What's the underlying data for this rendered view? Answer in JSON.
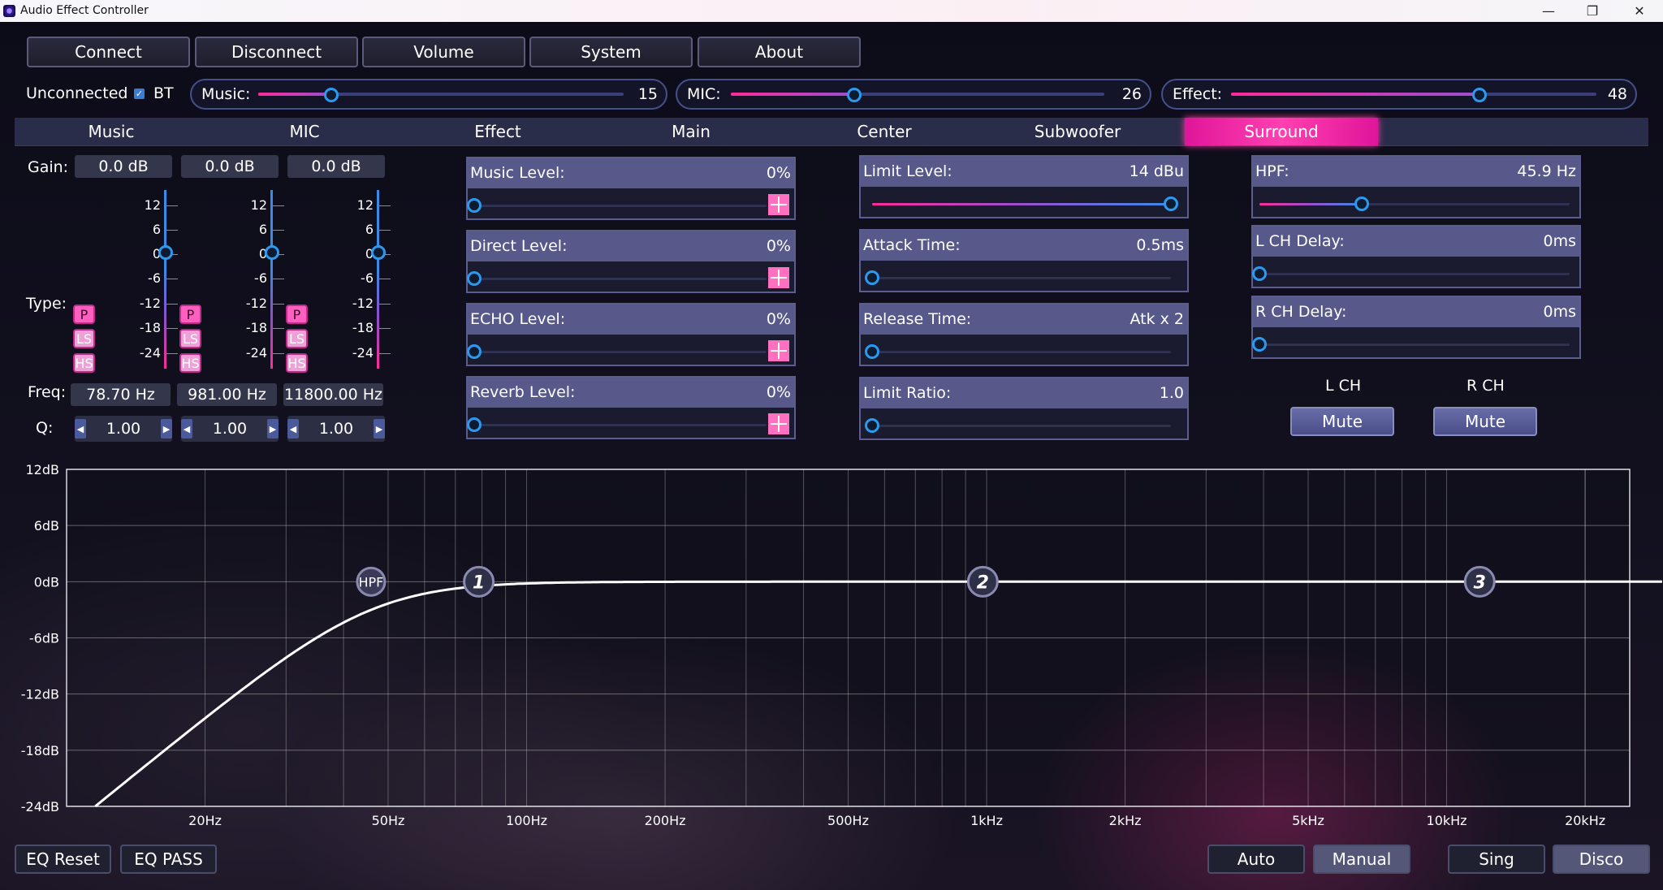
{
  "window": {
    "title": "Audio Effect Controller",
    "minimize": "—",
    "maximize": "❐",
    "close": "✕"
  },
  "menu": [
    "Connect",
    "Disconnect",
    "Volume",
    "System",
    "About"
  ],
  "status": {
    "connection": "Unconnected",
    "bt_label": "BT",
    "bt_checked": true
  },
  "levels": [
    {
      "label": "Music:",
      "value": "15",
      "fraction": 0.2
    },
    {
      "label": "MIC:",
      "value": "26",
      "fraction": 0.33
    },
    {
      "label": "Effect:",
      "value": "48",
      "fraction": 0.68
    }
  ],
  "tabs": [
    "Music",
    "MIC",
    "Effect",
    "Main",
    "Center",
    "Subwoofer",
    "Surround"
  ],
  "active_tab": "Surround",
  "eq": {
    "gain_label": "Gain:",
    "type_label": "Type:",
    "freq_label": "Freq:",
    "q_label": "Q:",
    "scale": [
      "12",
      "6",
      "0",
      "-6",
      "-12",
      "-18",
      "-24"
    ],
    "types": [
      "P",
      "LS",
      "HS"
    ],
    "bands": [
      {
        "gain": "0.0 dB",
        "freq": "78.70 Hz",
        "q": "1.00",
        "type": "P"
      },
      {
        "gain": "0.0 dB",
        "freq": "981.00 Hz",
        "q": "1.00",
        "type": "P"
      },
      {
        "gain": "0.0 dB",
        "freq": "11800.00 Hz",
        "q": "1.00",
        "type": "P"
      }
    ]
  },
  "effect_panels": [
    {
      "label": "Music Level:",
      "value": "0%",
      "fraction": 0
    },
    {
      "label": "Direct Level:",
      "value": "0%",
      "fraction": 0
    },
    {
      "label": "ECHO Level:",
      "value": "0%",
      "fraction": 0
    },
    {
      "label": "Reverb Level:",
      "value": "0%",
      "fraction": 0
    }
  ],
  "limiter_panels": [
    {
      "label": "Limit Level:",
      "value": "14 dBu",
      "fraction": 1.0
    },
    {
      "label": "Attack Time:",
      "value": "0.5ms",
      "fraction": 0
    },
    {
      "label": "Release Time:",
      "value": "Atk x  2",
      "fraction": 0
    },
    {
      "label": "Limit Ratio:",
      "value": "1.0",
      "fraction": 0
    }
  ],
  "surround_panels": [
    {
      "label": "HPF:",
      "value": "45.9 Hz",
      "fraction": 0.33
    },
    {
      "label": "L CH Delay:",
      "value": "0ms",
      "fraction": 0
    },
    {
      "label": "R CH Delay:",
      "value": "0ms",
      "fraction": 0
    }
  ],
  "channels": [
    {
      "label": "L CH",
      "button": "Mute"
    },
    {
      "label": "R CH",
      "button": "Mute"
    }
  ],
  "graph": {
    "y_labels": [
      "12dB",
      "6dB",
      "0dB",
      "-6dB",
      "-12dB",
      "-18dB",
      "-24dB"
    ],
    "x_labels": [
      "20Hz",
      "50Hz",
      "100Hz",
      "200Hz",
      "500Hz",
      "1kHz",
      "2kHz",
      "5kHz",
      "10kHz",
      "20kHz"
    ],
    "x_label_freqs": [
      20,
      50,
      100,
      200,
      500,
      1000,
      2000,
      5000,
      10000,
      20000
    ],
    "ylim": [
      -24,
      12
    ],
    "hpf_marker": "HPF",
    "hpf_freq": 45.9,
    "band_markers": [
      {
        "label": "1",
        "freq": 78.7
      },
      {
        "label": "2",
        "freq": 981
      },
      {
        "label": "3",
        "freq": 11800
      }
    ]
  },
  "bottom": {
    "left": [
      "EQ Reset",
      "EQ PASS"
    ],
    "mode": [
      "Auto",
      "Manual"
    ],
    "mode_selected": "Manual",
    "preset": [
      "Sing",
      "Disco"
    ],
    "preset_selected": "Disco"
  }
}
